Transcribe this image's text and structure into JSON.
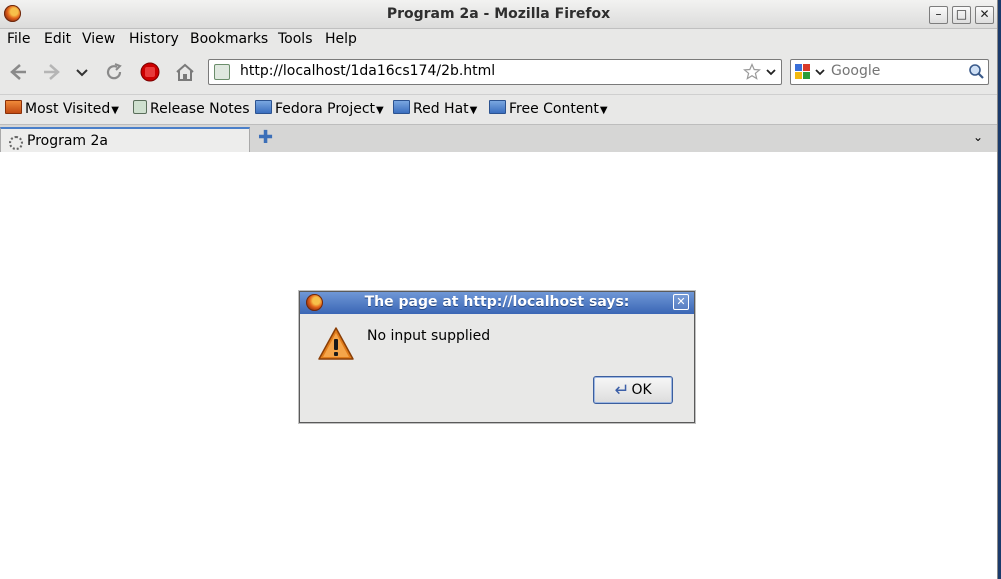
{
  "window": {
    "title": "Program 2a - Mozilla Firefox",
    "minimize_icon": "minimize-icon",
    "maximize_icon": "maximize-icon",
    "close_icon": "close-icon"
  },
  "menubar": {
    "items": [
      {
        "label": "File",
        "mnemonic": "F"
      },
      {
        "label": "Edit",
        "mnemonic": "E"
      },
      {
        "label": "View",
        "mnemonic": "V"
      },
      {
        "label": "History",
        "mnemonic": "s"
      },
      {
        "label": "Bookmarks",
        "mnemonic": "B"
      },
      {
        "label": "Tools",
        "mnemonic": "T"
      },
      {
        "label": "Help",
        "mnemonic": "H"
      }
    ]
  },
  "navbar": {
    "url": "http://localhost/1da16cs174/2b.html",
    "search_placeholder": "Google"
  },
  "bookmarks": {
    "items": [
      {
        "label": "Most Visited",
        "icon": "most-visited-icon"
      },
      {
        "label": "Release Notes",
        "icon": "page-icon"
      },
      {
        "label": "Fedora Project",
        "icon": "folder-icon"
      },
      {
        "label": "Red Hat",
        "icon": "folder-icon"
      },
      {
        "label": "Free Content",
        "icon": "folder-icon"
      }
    ]
  },
  "tabs": {
    "active_label": "Program 2a"
  },
  "dialog": {
    "title": "The page at http://localhost says:",
    "message": "No input supplied",
    "ok_label": "OK"
  },
  "colors": {
    "dialog_title_bg": "#3a66b5",
    "warning": "#e07b1a",
    "stop": "#cc0000"
  }
}
